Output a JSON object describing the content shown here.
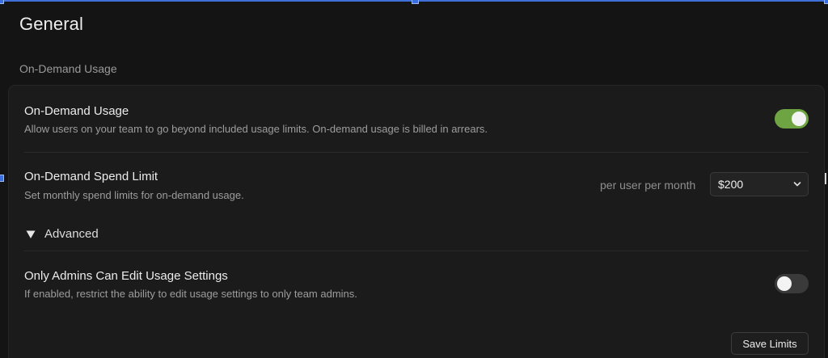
{
  "page": {
    "title": "General",
    "section_label": "On-Demand Usage"
  },
  "on_demand_usage": {
    "title": "On-Demand Usage",
    "description": "Allow users on your team to go beyond included usage limits. On-demand usage is billed in arrears.",
    "enabled": true
  },
  "spend_limit": {
    "title": "On-Demand Spend Limit",
    "description": "Set monthly spend limits for on-demand usage.",
    "unit_label": "per user per month",
    "selected_value": "$200",
    "dropdown_icon": "chevron-down-icon"
  },
  "advanced": {
    "label": "Advanced",
    "expanded": true,
    "icon": "triangle-down-icon"
  },
  "admins_only": {
    "title": "Only Admins Can Edit Usage Settings",
    "description": "If enabled, restrict the ability to edit usage settings to only team admins.",
    "enabled": false
  },
  "actions": {
    "save_label": "Save Limits"
  },
  "colors": {
    "background": "#141414",
    "card": "#1b1b1b",
    "toggle_on": "#6ea542",
    "toggle_off": "#3a3a3a",
    "selection_accent": "#3a6fe0"
  }
}
